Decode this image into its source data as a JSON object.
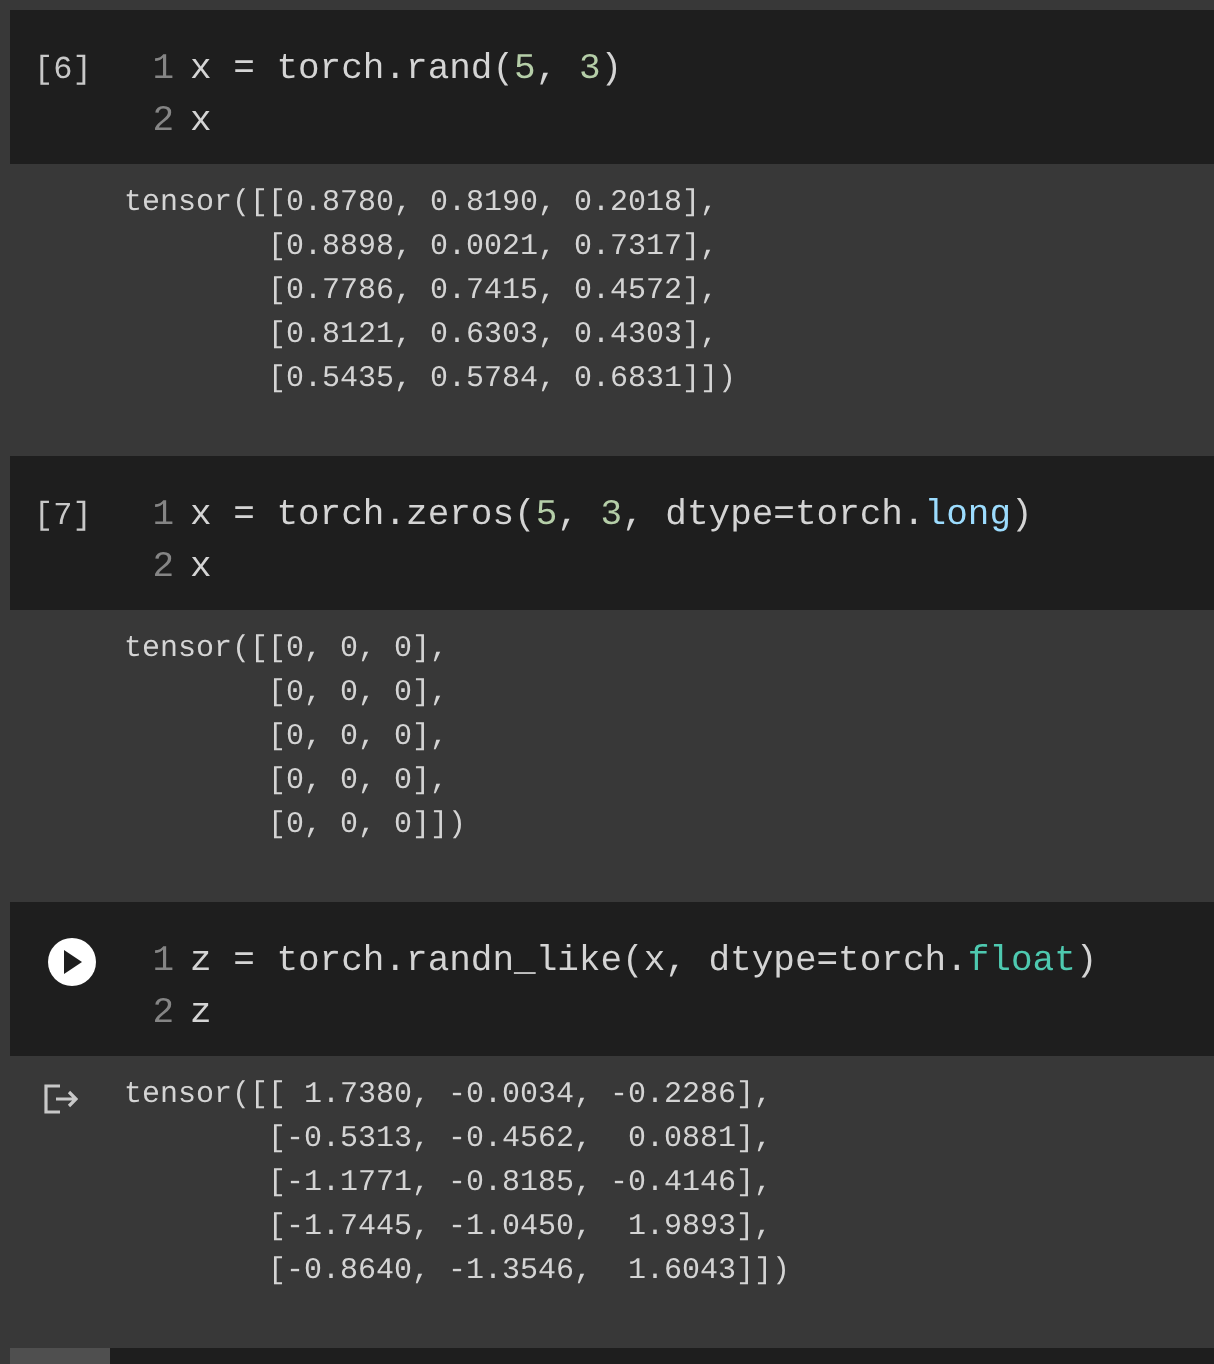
{
  "cells": [
    {
      "prompt": {
        "kind": "count",
        "text": "[6]"
      },
      "code_lines": [
        {
          "number": "1",
          "tokens": [
            {
              "kind": "plain",
              "text": "x = torch.rand("
            },
            {
              "kind": "number",
              "text": "5"
            },
            {
              "kind": "plain",
              "text": ", "
            },
            {
              "kind": "number",
              "text": "3"
            },
            {
              "kind": "plain",
              "text": ")"
            }
          ]
        },
        {
          "number": "2",
          "tokens": [
            {
              "kind": "plain",
              "text": "x"
            }
          ]
        }
      ],
      "output": {
        "icon": false,
        "lines": [
          "tensor([[0.8780, 0.8190, 0.2018],",
          "        [0.8898, 0.0021, 0.7317],",
          "        [0.7786, 0.7415, 0.4572],",
          "        [0.8121, 0.6303, 0.4303],",
          "        [0.5435, 0.5784, 0.6831]])"
        ]
      }
    },
    {
      "prompt": {
        "kind": "count",
        "text": "[7]"
      },
      "code_lines": [
        {
          "number": "1",
          "tokens": [
            {
              "kind": "plain",
              "text": "x = torch.zeros("
            },
            {
              "kind": "number",
              "text": "5"
            },
            {
              "kind": "plain",
              "text": ", "
            },
            {
              "kind": "number",
              "text": "3"
            },
            {
              "kind": "plain",
              "text": ", dtype=torch."
            },
            {
              "kind": "attribute",
              "text": "long"
            },
            {
              "kind": "plain",
              "text": ")"
            }
          ]
        },
        {
          "number": "2",
          "tokens": [
            {
              "kind": "plain",
              "text": "x"
            }
          ]
        }
      ],
      "output": {
        "icon": false,
        "lines": [
          "tensor([[0, 0, 0],",
          "        [0, 0, 0],",
          "        [0, 0, 0],",
          "        [0, 0, 0],",
          "        [0, 0, 0]])"
        ]
      }
    },
    {
      "prompt": {
        "kind": "run"
      },
      "code_lines": [
        {
          "number": "1",
          "tokens": [
            {
              "kind": "plain",
              "text": "z = torch.randn_like(x, dtype=torch."
            },
            {
              "kind": "type",
              "text": "float"
            },
            {
              "kind": "plain",
              "text": ")"
            }
          ]
        },
        {
          "number": "2",
          "tokens": [
            {
              "kind": "plain",
              "text": "z"
            }
          ]
        }
      ],
      "output": {
        "icon": true,
        "lines": [
          "tensor([[ 1.7380, -0.0034, -0.2286],",
          "        [-0.5313, -0.4562,  0.0881],",
          "        [-1.1771, -0.8185, -0.4146],",
          "        [-1.7445, -1.0450,  1.9893],",
          "        [-0.8640, -1.3546,  1.6043]])"
        ]
      }
    }
  ]
}
